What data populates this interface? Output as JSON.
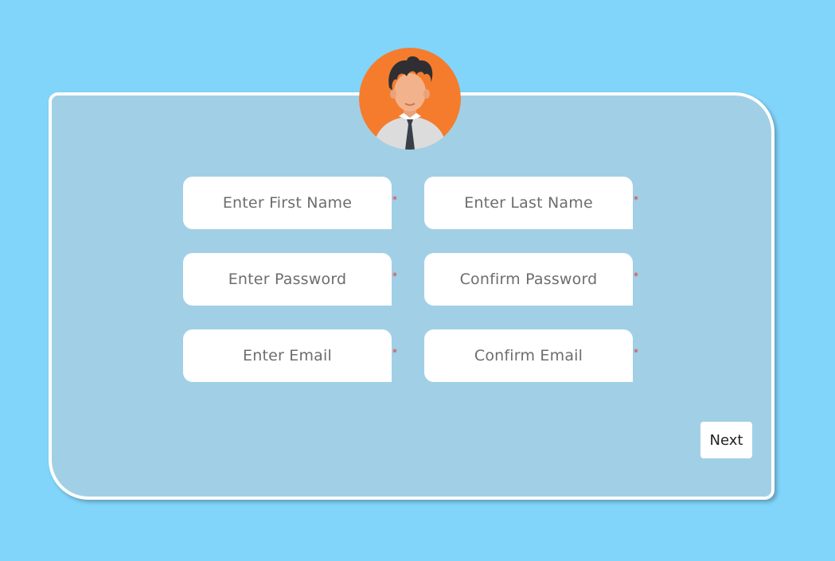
{
  "form": {
    "fields": [
      {
        "placeholder": "Enter First Name",
        "required_mark": "*"
      },
      {
        "placeholder": "Enter Last Name",
        "required_mark": "*"
      },
      {
        "placeholder": "Enter Password",
        "required_mark": "*"
      },
      {
        "placeholder": "Confirm Password",
        "required_mark": "*"
      },
      {
        "placeholder": "Enter Email",
        "required_mark": "*"
      },
      {
        "placeholder": "Confirm Email",
        "required_mark": "*"
      }
    ],
    "next_label": "Next"
  },
  "avatar": {
    "icon": "user-avatar-icon"
  },
  "colors": {
    "background": "#81d4fa",
    "card": "#a1d0e6",
    "avatar_circle": "#f57c2d",
    "required": "#e53935"
  }
}
